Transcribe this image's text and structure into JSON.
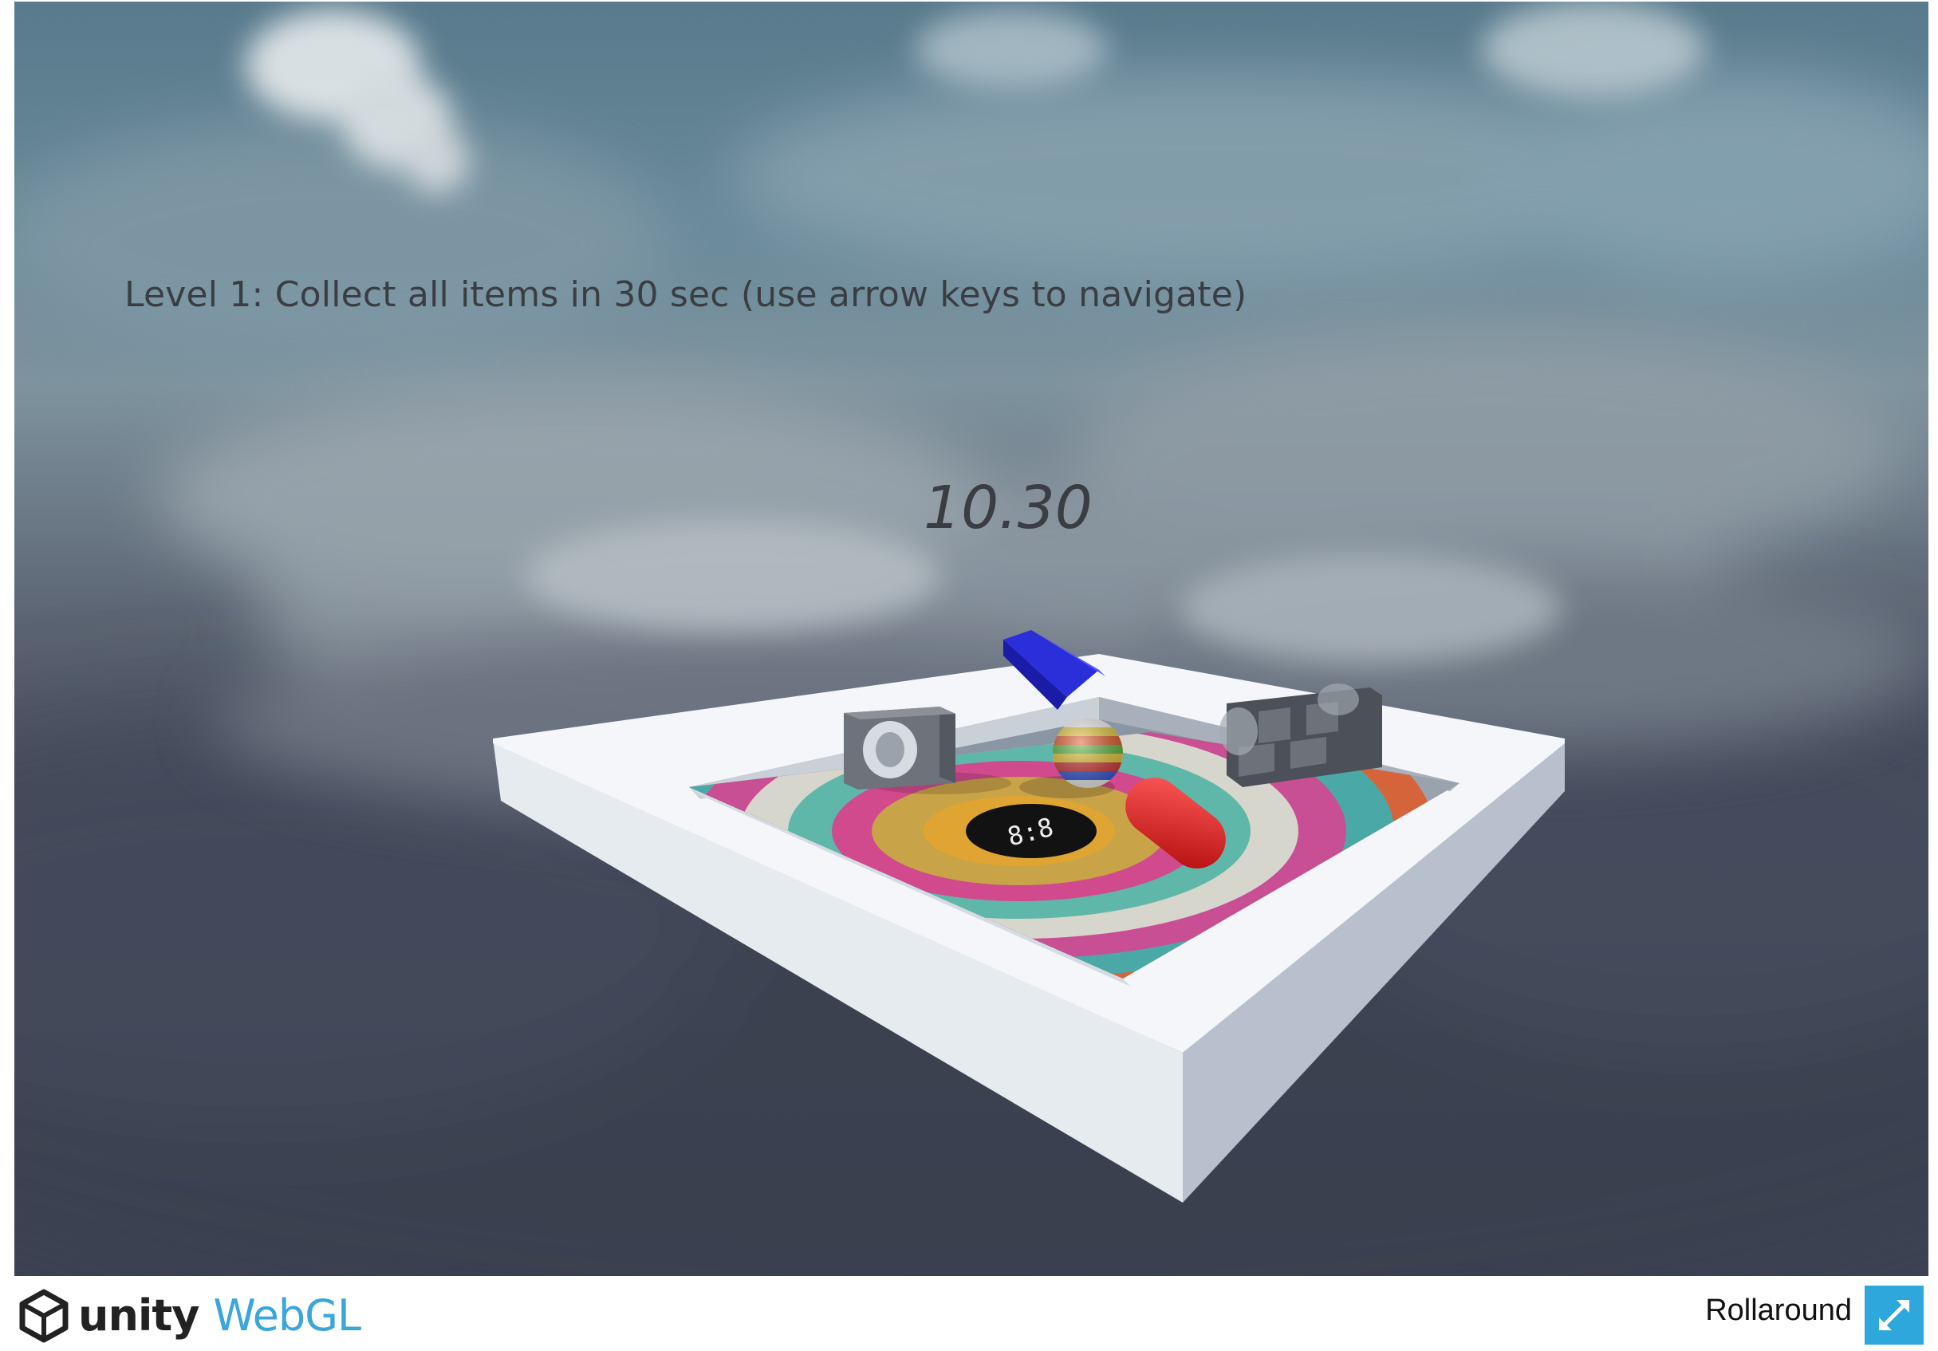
{
  "hud": {
    "instructions": "Level 1: Collect all items in 30 sec (use arrow keys to navigate)",
    "timer": "10.30"
  },
  "scene": {
    "floor_sign": "8:8"
  },
  "footer": {
    "brand_unity": "unity",
    "brand_webgl": "WebGL",
    "game_title": "Rollaround",
    "fullscreen_icon": "fullscreen-icon",
    "logo_icon": "unity-cube-icon"
  },
  "colors": {
    "accent": "#2ea7dc",
    "webgl_text": "#3aa6d9",
    "hud_text": "#3a3e44"
  }
}
